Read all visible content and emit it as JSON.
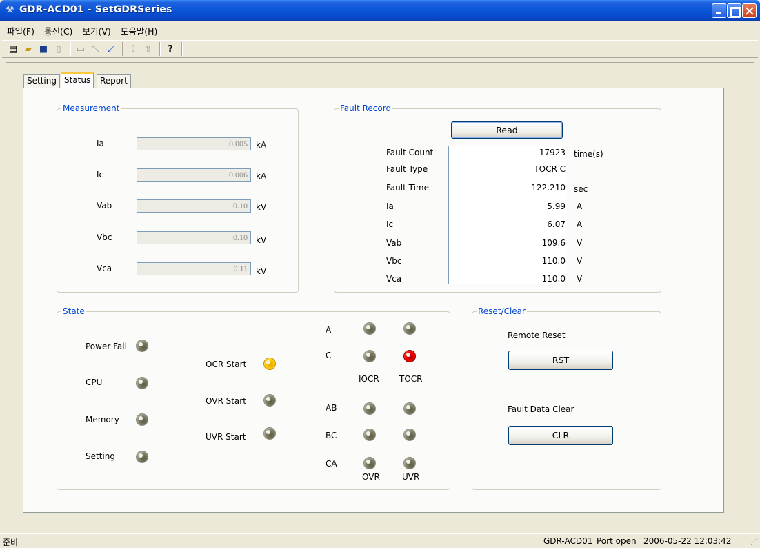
{
  "window": {
    "title": "GDR-ACD01 - SetGDRSeries",
    "app_icon": "tools-icon",
    "controls": [
      "minimize-icon",
      "maximize-icon",
      "close-icon"
    ]
  },
  "menu": [
    {
      "label": "파일(F)"
    },
    {
      "label": "통신(C)"
    },
    {
      "label": "보기(V)"
    },
    {
      "label": "도움말(H)"
    }
  ],
  "toolbar": {
    "icons": [
      "grid-icon",
      "open-folder-icon",
      "save-icon",
      "document-icon",
      "monitor-icon",
      "connect-icon",
      "disconnect-icon",
      "download-icon",
      "upload-icon",
      "help-icon"
    ]
  },
  "tabs": [
    {
      "label": "Setting",
      "active": false
    },
    {
      "label": "Status",
      "active": true
    },
    {
      "label": "Report",
      "active": false
    }
  ],
  "measurement": {
    "title": "Measurement",
    "rows": [
      {
        "label": "Ia",
        "value": "0.005",
        "unit": "kA"
      },
      {
        "label": "Ic",
        "value": "0.006",
        "unit": "kA"
      },
      {
        "label": "Vab",
        "value": "0.10",
        "unit": "kV"
      },
      {
        "label": "Vbc",
        "value": "0.10",
        "unit": "kV"
      },
      {
        "label": "Vca",
        "value": "0.11",
        "unit": "kV"
      }
    ]
  },
  "fault_record": {
    "title": "Fault Record",
    "read_label": "Read",
    "rows": [
      {
        "label": "Fault Count",
        "value": "17923",
        "unit": "time(s)"
      },
      {
        "label": "Fault Type",
        "value": "TOCR C",
        "unit": ""
      },
      {
        "label": "Fault Time",
        "value": "122.210",
        "unit": "sec"
      },
      {
        "label": "Ia",
        "value": "5.99",
        "unit": "A"
      },
      {
        "label": "Ic",
        "value": "6.07",
        "unit": "A"
      },
      {
        "label": "Vab",
        "value": "109.6",
        "unit": "V"
      },
      {
        "label": "Vbc",
        "value": "110.0",
        "unit": "V"
      },
      {
        "label": "Vca",
        "value": "110.0",
        "unit": "V"
      }
    ]
  },
  "state": {
    "title": "State",
    "system": [
      {
        "label": "Power Fail",
        "color": "#7d7d66"
      },
      {
        "label": "CPU",
        "color": "#7d7d66"
      },
      {
        "label": "Memory",
        "color": "#7d7d66"
      },
      {
        "label": "Setting",
        "color": "#7d7d66"
      }
    ],
    "start": [
      {
        "label": "OCR Start",
        "color": "#ffcc00"
      },
      {
        "label": "OVR Start",
        "color": "#7d7d66"
      },
      {
        "label": "UVR Start",
        "color": "#7d7d66"
      }
    ],
    "phase_labels": [
      "A",
      "C",
      "AB",
      "BC",
      "CA"
    ],
    "col_labels": [
      "IOCR",
      "TOCR",
      "OVR",
      "UVR"
    ],
    "active_color": "#ff0000"
  },
  "reset_clear": {
    "title": "Reset/Clear",
    "remote_reset_label": "Remote Reset",
    "rst_label": "RST",
    "fault_clear_label": "Fault Data Clear",
    "clr_label": "CLR"
  },
  "statusbar": {
    "ready": "준비",
    "device": "GDR-ACD01",
    "port": "Port open",
    "datetime": "2006-05-22 12:03:42"
  }
}
